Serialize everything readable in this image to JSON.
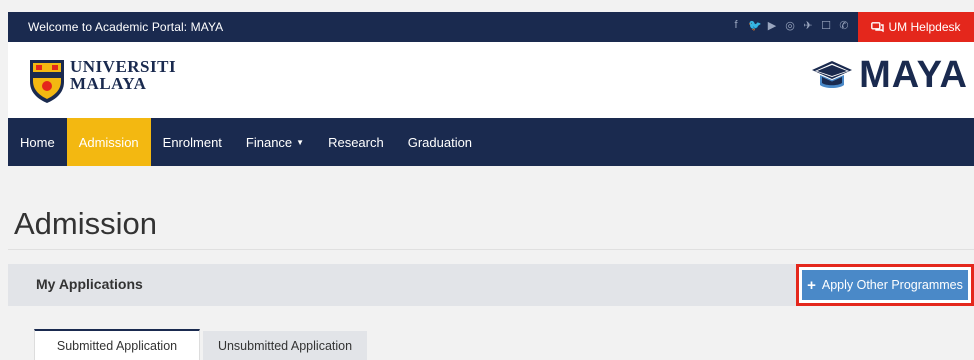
{
  "topbar": {
    "welcome": "Welcome to Academic Portal: MAYA",
    "socials": [
      "f",
      "🐦",
      "▶",
      "◎",
      "✈",
      "☐",
      "✆"
    ],
    "helpdesk_label": "UM Helpdesk"
  },
  "brand": {
    "university_line1": "UNIVERSITI",
    "university_line2": "MALAYA",
    "portal_name": "MAYA"
  },
  "nav": {
    "items": [
      {
        "label": "Home"
      },
      {
        "label": "Admission"
      },
      {
        "label": "Enrolment"
      },
      {
        "label": "Finance"
      },
      {
        "label": "Research"
      },
      {
        "label": "Graduation"
      }
    ],
    "active": "Admission"
  },
  "page": {
    "title": "Admission"
  },
  "panel": {
    "title": "My Applications",
    "apply_button": "Apply Other Programmes"
  },
  "tabs": {
    "submitted": "Submitted Application",
    "unsubmitted": "Unsubmitted Application"
  },
  "colors": {
    "navy": "#1a2a4f",
    "accent_yellow": "#f3b811",
    "helpdesk_red": "#e4271c",
    "button_blue": "#4a89c8"
  }
}
